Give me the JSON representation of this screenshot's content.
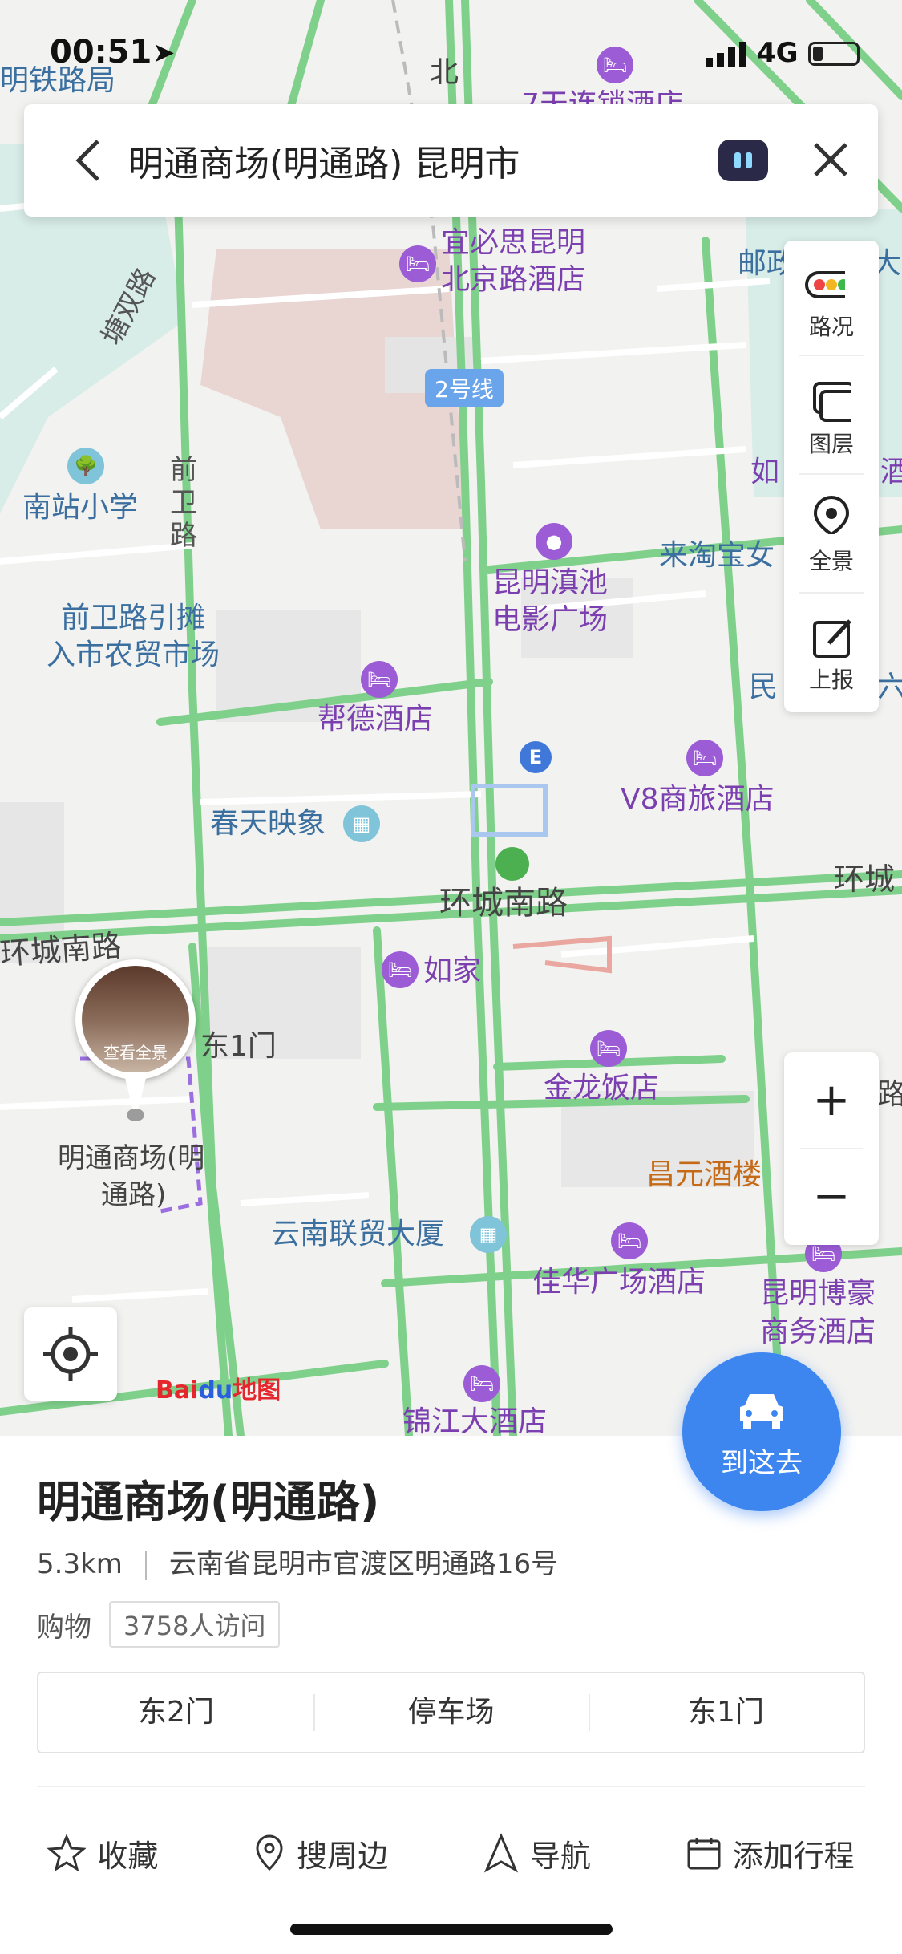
{
  "status": {
    "time": "00:51",
    "network": "4G"
  },
  "search": {
    "query": "明通商场(明通路) 昆明市"
  },
  "map": {
    "labels": {
      "tielu": "明铁路局",
      "liansuo": "7天连锁酒店",
      "bei": "北",
      "ibis": "宜必思昆明",
      "ibis2": "北京路酒店",
      "you": "邮政",
      "da": "大",
      "tangshuang": "塘双路",
      "line2": "2号线",
      "qianwei": "前卫路",
      "nanzhan": "南站小学",
      "ru": "如",
      "jiu": "酒",
      "laitao": "来淘宝女",
      "dianchi": "昆明滇池",
      "dianchi2": "电影广场",
      "qianweimarket": "前卫路引摊",
      "qianweimarket2": "入市农贸市场",
      "min": "民",
      "liu": "六",
      "bangde": "帮德酒店",
      "e": "E",
      "v8": "V8商旅酒店",
      "chuntian": "春天映象",
      "huancheng": "环城南路",
      "huancheng_left": "环城南路",
      "huancheng_right": "环城",
      "rujia": "如家",
      "dong1": "东1门",
      "panorama": "查看全景",
      "mingtong": "明通商场(明",
      "mingtong2": "通路)",
      "jinlong": "金龙饭店",
      "lu": "路",
      "changyuan": "昌元酒楼",
      "lianmao": "云南联贸大厦",
      "jiahua": "佳华广场酒店",
      "bohao": "昆明博豪",
      "bohao2": "商务酒店",
      "jinjiang": "锦江大酒店"
    }
  },
  "side_panel": {
    "traffic": "路况",
    "layers": "图层",
    "panorama": "全景",
    "report": "上报"
  },
  "zoom": {
    "in": "+",
    "out": "−"
  },
  "baidu": {
    "bai": "Bai",
    "du": "du",
    "ditu": "地图"
  },
  "go": {
    "label": "到这去"
  },
  "place": {
    "name": "明通商场(明通路)",
    "distance": "5.3km",
    "address": "云南省昆明市官渡区明通路16号",
    "category": "购物",
    "visits": "3758人访问",
    "gates": [
      "东2门",
      "停车场",
      "东1门"
    ]
  },
  "actions": {
    "favorite": "收藏",
    "nearby": "搜周边",
    "navigate": "导航",
    "itinerary": "添加行程"
  }
}
